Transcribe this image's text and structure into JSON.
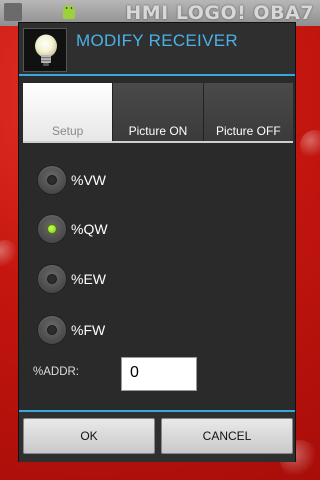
{
  "statusbar": {
    "app_title": "HMI LOGO! OBA7",
    "icons": [
      "usb-icon",
      "android-icon"
    ]
  },
  "dialog": {
    "title": "MODIFY RECEIVER",
    "icon": "lightbulb-icon",
    "accent_color": "#39a6e0"
  },
  "tabs": [
    {
      "label": "Setup",
      "active": true
    },
    {
      "label": "Picture ON",
      "active": false
    },
    {
      "label": "Picture OFF",
      "active": false
    }
  ],
  "options": [
    {
      "label": "%VW",
      "checked": false
    },
    {
      "label": "%QW",
      "checked": true
    },
    {
      "label": "%EW",
      "checked": false
    },
    {
      "label": "%FW",
      "checked": false
    }
  ],
  "address": {
    "label": "%ADDR:",
    "value": "0"
  },
  "buttons": {
    "ok": "OK",
    "cancel": "CANCEL"
  }
}
